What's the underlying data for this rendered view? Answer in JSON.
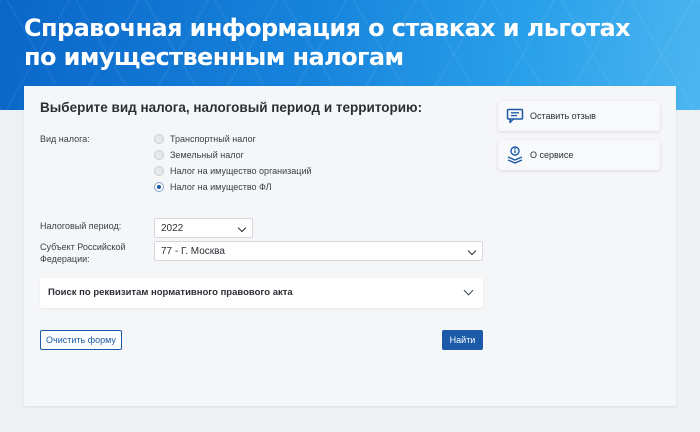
{
  "header": {
    "title": "Справочная информация о ставках и льготах по имущественным налогам"
  },
  "form": {
    "title": "Выберите вид налога, налоговый период и территорию:",
    "tax_type_label": "Вид налога:",
    "tax_types": [
      {
        "label": "Транспортный налог",
        "checked": false
      },
      {
        "label": "Земельный налог",
        "checked": false
      },
      {
        "label": "Налог на имущество организаций",
        "checked": false
      },
      {
        "label": "Налог на имущество ФЛ",
        "checked": true
      }
    ],
    "period_label": "Налоговый период:",
    "period_value": "2022",
    "region_label_line1": "Субъект Российской",
    "region_label_line2": "Федерации:",
    "region_value": "77 - Г. Москва",
    "accordion_title": "Поиск по реквизитам нормативного правового акта",
    "clear_button": "Очистить форму",
    "find_button": "Найти"
  },
  "sidebar": {
    "feedback": {
      "label": "Оставить отзыв",
      "icon": "chat-icon"
    },
    "about": {
      "label": "О сервисе",
      "icon": "info-stack-icon"
    }
  },
  "colors": {
    "accent": "#1a5aa8",
    "banner_start": "#0a66c8",
    "banner_end": "#4cb6f0"
  }
}
